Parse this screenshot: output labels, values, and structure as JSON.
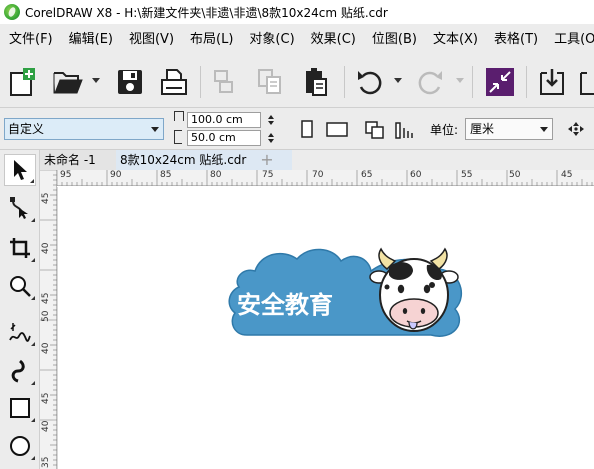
{
  "window": {
    "title": "CorelDRAW X8 - H:\\新建文件夹\\非遗\\非遗\\8款10x24cm 贴纸.cdr"
  },
  "menu": [
    {
      "id": "file",
      "label": "文件(F)"
    },
    {
      "id": "edit",
      "label": "编辑(E)"
    },
    {
      "id": "view",
      "label": "视图(V)"
    },
    {
      "id": "layout",
      "label": "布局(L)"
    },
    {
      "id": "object",
      "label": "对象(C)"
    },
    {
      "id": "effects",
      "label": "效果(C)"
    },
    {
      "id": "bitmaps",
      "label": "位图(B)"
    },
    {
      "id": "text",
      "label": "文本(X)"
    },
    {
      "id": "table",
      "label": "表格(T)"
    },
    {
      "id": "tools",
      "label": "工具(O)"
    }
  ],
  "propertybar": {
    "page_preset": "自定义",
    "width": "100.0 cm",
    "height": "50.0 cm",
    "unit_label": "单位:",
    "unit_value": "厘米"
  },
  "tabs": [
    {
      "label": "未命名 -1",
      "active": false
    },
    {
      "label": "8款10x24cm 贴纸.cdr",
      "active": true
    }
  ],
  "rulers": {
    "horizontal": [
      "95",
      "90",
      "85",
      "80",
      "75",
      "70",
      "65",
      "60",
      "55",
      "50",
      "45"
    ],
    "vertical": [
      "45",
      "40",
      "45",
      "50",
      "40",
      "45",
      "40",
      "35"
    ]
  },
  "sticker": {
    "text": "安全教育",
    "colors": {
      "cloud_fill": "#4a97c8",
      "cloud_outline": "#ffffff",
      "cow_face": "#ffffff",
      "cow_nose": "#f6d3d3",
      "cow_horn": "#f2e2a4",
      "tongue": "#c9c9ff"
    }
  },
  "colors": {
    "chrome": "#ececec",
    "active_tab": "#dde8f3",
    "preset_bg": "#dcecf8",
    "transform_icon": "#5a1e6e"
  }
}
